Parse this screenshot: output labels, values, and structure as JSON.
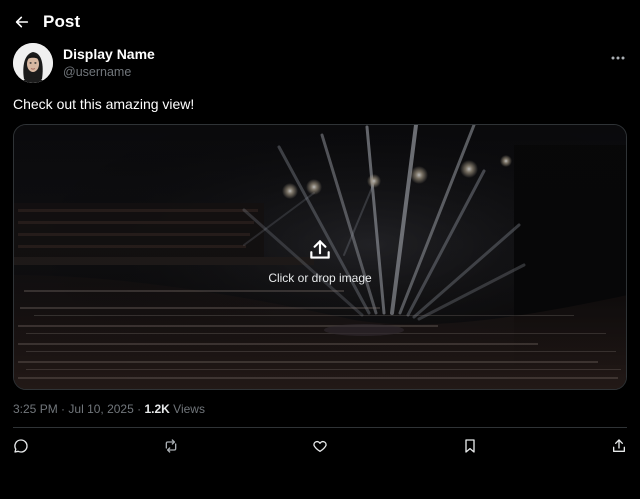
{
  "header": {
    "title": "Post",
    "back_icon": "arrow-left-icon"
  },
  "author": {
    "display_name": "Display Name",
    "username": "@username",
    "avatar_icon": "user-avatar",
    "more_icon": "more-horizontal-icon"
  },
  "post": {
    "text": "Check out this amazing view!",
    "media": {
      "upload_label": "Click or drop image",
      "upload_icon": "upload-icon"
    }
  },
  "meta": {
    "time": "3:25 PM",
    "separator": "·",
    "date": "Jul 10, 2025",
    "views_count": "1.2K",
    "views_label": "Views"
  },
  "actions": [
    {
      "name": "reply",
      "icon": "reply-icon"
    },
    {
      "name": "repost",
      "icon": "repost-icon"
    },
    {
      "name": "like",
      "icon": "heart-icon"
    },
    {
      "name": "bookmark",
      "icon": "bookmark-icon"
    },
    {
      "name": "share",
      "icon": "share-icon"
    }
  ],
  "colors": {
    "background": "#000000",
    "text_primary": "#e7e9ea",
    "text_secondary": "#71767b",
    "border": "#2f3336"
  }
}
